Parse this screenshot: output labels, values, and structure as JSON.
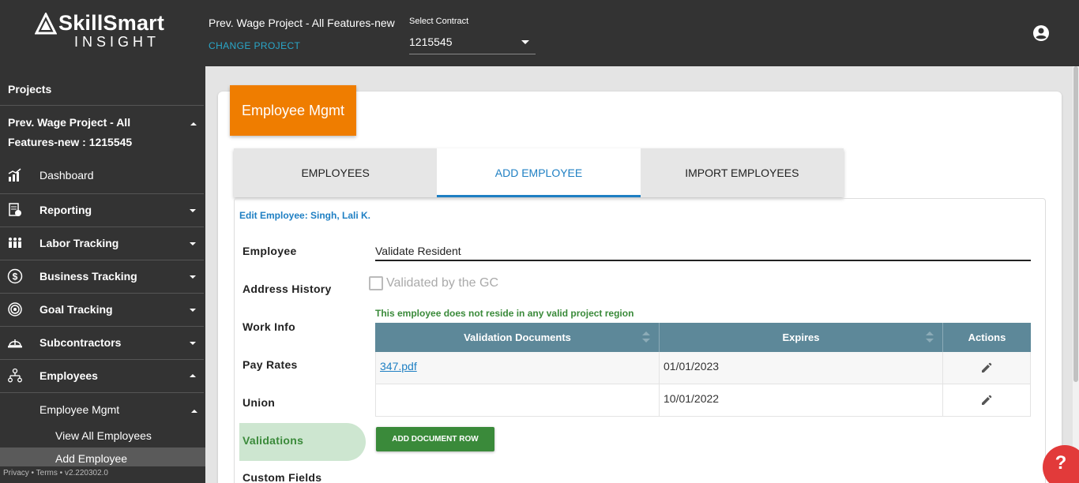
{
  "app": {
    "logo_text": "SkillSmart",
    "logo_sub": "INSIGHT",
    "project_title": "Prev. Wage Project - All Features-new",
    "change_project": "CHANGE PROJECT",
    "contract_label": "Select Contract",
    "contract_value": "1215545"
  },
  "sidebar": {
    "projects_label": "Projects",
    "project_name": "Prev. Wage Project - All Features-new : 1215545",
    "items": [
      {
        "label": "Dashboard",
        "icon": "dashboard-icon"
      },
      {
        "label": "Reporting",
        "icon": "report-icon"
      },
      {
        "label": "Labor Tracking",
        "icon": "workers-icon"
      },
      {
        "label": "Business Tracking",
        "icon": "dollar-icon"
      },
      {
        "label": "Goal Tracking",
        "icon": "target-icon"
      },
      {
        "label": "Subcontractors",
        "icon": "hardhat-icon"
      },
      {
        "label": "Employees",
        "icon": "org-chart-icon"
      }
    ],
    "sub_item": "Employee Mgmt",
    "sub_sub_items": [
      "View All Employees",
      "Add Employee"
    ],
    "footer": "Privacy • Terms • v2.220302.0"
  },
  "main": {
    "header": "Employee Mgmt",
    "tabs": [
      "EMPLOYEES",
      "ADD EMPLOYEE",
      "IMPORT EMPLOYEES"
    ],
    "active_tab": "ADD EMPLOYEE",
    "edit_label": "Edit Employee: Singh, Lali K.",
    "left_nav": [
      "Employee",
      "Address History",
      "Work Info",
      "Pay Rates",
      "Union",
      "Validations",
      "Custom Fields"
    ],
    "active_nav": "Validations",
    "validate_field_value": "Validate Resident",
    "checkbox_label": "Validated by the GC",
    "warning": "This employee does not reside in any valid project region",
    "table": {
      "headers": [
        "Validation Documents",
        "Expires",
        "Actions"
      ],
      "rows": [
        {
          "document": "347.pdf",
          "expires": "01/01/2023"
        },
        {
          "document": "",
          "expires": "10/01/2022"
        }
      ]
    },
    "add_row_button": "ADD DOCUMENT ROW"
  },
  "help_label": "?",
  "colors": {
    "topbar": "#333333",
    "accent_orange": "#ef7d00",
    "accent_blue": "#1e7fc3",
    "accent_green": "#3a8a3a",
    "table_header": "#5d8899",
    "help_red": "#e23a3a"
  }
}
